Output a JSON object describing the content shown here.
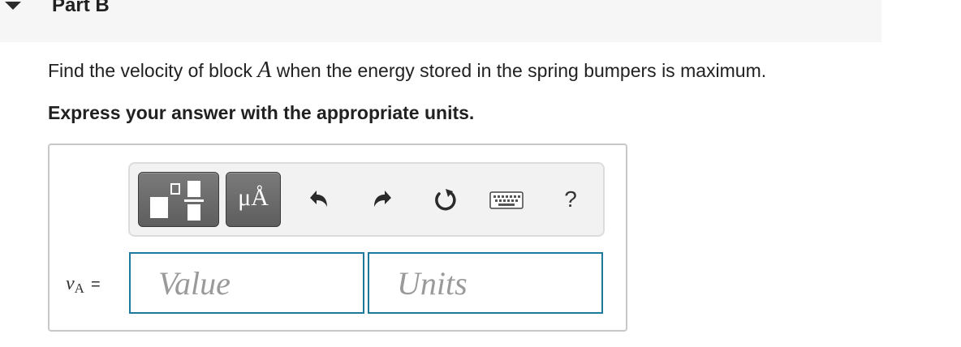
{
  "part": {
    "title": "Part B"
  },
  "question": {
    "text_before": "Find the velocity of block ",
    "variable": "A",
    "text_after": " when the energy stored in the spring bumpers is maximum."
  },
  "instruction": "Express your answer with the appropriate units.",
  "toolbar": {
    "units_label": "μÅ",
    "help_label": "?",
    "icons": [
      "templates-icon",
      "units-icon",
      "undo-icon",
      "redo-icon",
      "reset-icon",
      "keyboard-icon",
      "help-icon"
    ]
  },
  "answer": {
    "variable": "v",
    "subscript": "A",
    "equals": "=",
    "value_placeholder": "Value",
    "units_placeholder": "Units"
  },
  "colors": {
    "header_bg": "#f6f6f6",
    "field_border": "#1e7a9c",
    "toolbar_button": "#6a6a6a"
  }
}
